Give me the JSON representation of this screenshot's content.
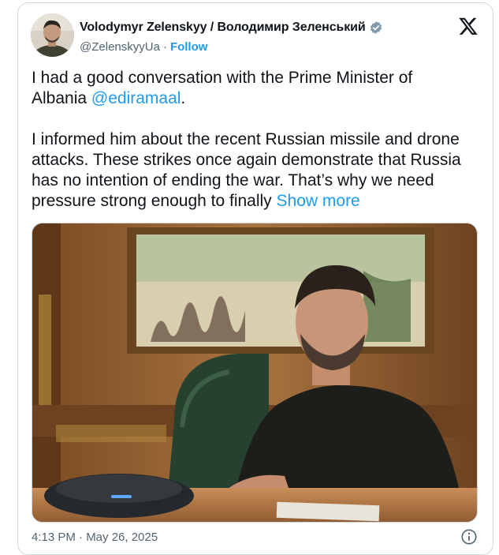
{
  "tweet": {
    "display_name": "Volodymyr Zelenskyy / Володимир Зеленський",
    "handle": "@ZelenskyyUa",
    "separator": "·",
    "follow_label": "Follow",
    "text_part1": "I had a good conversation with the Prime Minister of\nAlbania ",
    "mention": "@ediramaal",
    "text_part2": ".\n\nI informed him about the recent Russian missile and drone attacks. These strikes once again demonstrate that Russia has no intention of ending the war. That’s why we need pressure strong enough to finally ",
    "show_more_label": "Show more",
    "timestamp": "4:13 PM · May 26, 2025"
  },
  "icons": {
    "verified": "verified-badge-icon",
    "logo": "x-logo-icon",
    "info": "info-icon"
  },
  "colors": {
    "link": "#1d9bf0",
    "secondary_text": "#536471",
    "border": "#cfd9de",
    "verified_badge": "#829aab"
  }
}
